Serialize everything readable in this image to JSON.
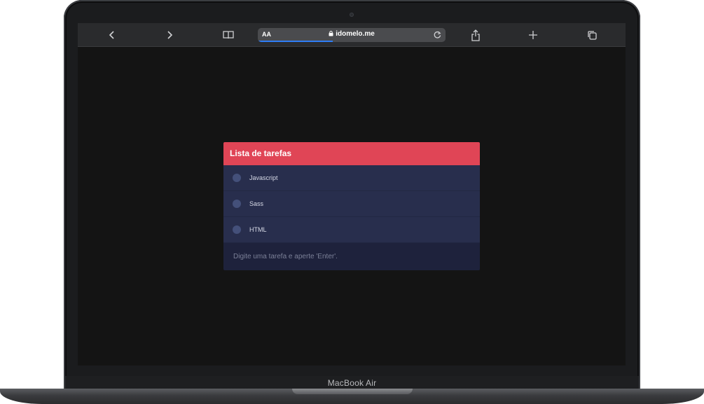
{
  "device": {
    "label": "MacBook Air"
  },
  "browser": {
    "address_prefix": "AA",
    "url": "idomelo.me",
    "icons": [
      "chevron-left-icon",
      "chevron-right-icon",
      "book-icon",
      "lock-icon",
      "reload-icon",
      "share-icon",
      "plus-icon",
      "tabs-icon"
    ],
    "load_progress": 0.4
  },
  "todo": {
    "title": "Lista de tarefas",
    "tasks": [
      {
        "label": "Javascript"
      },
      {
        "label": "Sass"
      },
      {
        "label": "HTML"
      }
    ],
    "input_placeholder": "Digite uma tarefa e aperte 'Enter'."
  },
  "colors": {
    "header": "#e04556",
    "task_bg": "#282e4d",
    "input_bg": "#1e223c",
    "screen_bg": "#141414"
  }
}
